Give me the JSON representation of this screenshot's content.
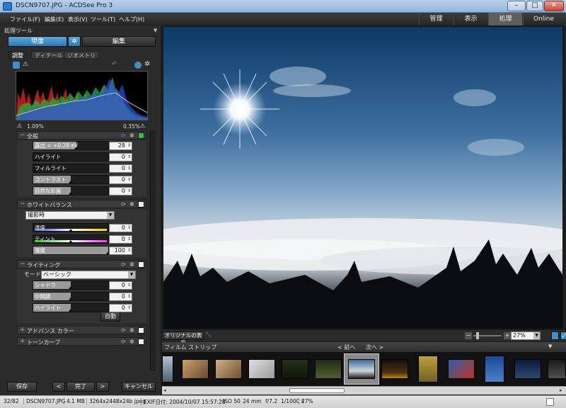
{
  "window": {
    "title": "DSCN9707.JPG - ACDSee Pro 3",
    "min": "–",
    "max": "□",
    "close": "✕"
  },
  "menu": [
    "ファイル(F)",
    "編集(E)",
    "表示(V)",
    "ツール(T)",
    "ヘルプ(H)"
  ],
  "modes": {
    "manage": "管理",
    "view": "表示",
    "process": "処理",
    "online": "Online",
    "active": "処理"
  },
  "left": {
    "panel_title": "処理ツール",
    "develop_tab": "現像",
    "edit_tab": "編集",
    "subtabs": [
      "調整",
      "ディテール",
      "ジオメトリ"
    ],
    "histogram": {
      "left_pct": "1.09%",
      "right_pct": "0.35%"
    },
    "general": {
      "title": "全般",
      "sliders": [
        {
          "label": "露出 = +0.28 eV",
          "value": "28",
          "level": 0.58
        },
        {
          "label": "ハイライト",
          "value": "0",
          "level": 0.0
        },
        {
          "label": "フィルライト",
          "value": "0",
          "level": 0.0
        },
        {
          "label": "コントラスト",
          "value": "0",
          "level": 0.5
        },
        {
          "label": "自然な彩度",
          "value": "0",
          "level": 0.5
        }
      ]
    },
    "white_balance": {
      "title": "ホワイトバランス",
      "preset": "撮影時",
      "sliders": [
        {
          "label": "温度",
          "value": "0",
          "level": 0.5
        },
        {
          "label": "ティント",
          "value": "0",
          "level": 0.5
        },
        {
          "label": "強度",
          "value": "100",
          "level": 1.0
        }
      ]
    },
    "lighting": {
      "title": "ライティング",
      "mode_label": "モード",
      "mode": "ベーシック",
      "sliders": [
        {
          "label": "シャドウ",
          "value": "0",
          "level": 0.5
        },
        {
          "label": "中間調",
          "value": "0",
          "level": 0.5
        },
        {
          "label": "ハイライト",
          "value": "0",
          "level": 0.5
        }
      ],
      "auto": "自動"
    },
    "advanced_color": {
      "title": "アドバンス カラー"
    },
    "tone_curve": {
      "title": "トーンカーブ"
    },
    "footer": {
      "save": "保存",
      "prev": "<",
      "done": "完了",
      "next": ">",
      "cancel": "キャンセル"
    }
  },
  "viewer": {
    "original_btn": "オリジナルの表示",
    "zoom": "27%",
    "zoom_minus": "−",
    "zoom_plus": "+"
  },
  "filmstrip": {
    "title": "フィルム ストリップ",
    "prev": "< 前へ",
    "next": "次へ >"
  },
  "status": {
    "index": "32/82",
    "file": "DSCN9707.JPG",
    "size": "4.1 MB",
    "dims": "3264x2448x24b jpeg",
    "exif": "EXIF日付: 2004/10/07 15:57:28",
    "iso": "ISO 50",
    "focal": "24 mm",
    "fstop": "f/7.2",
    "shutter": "1/1000 s",
    "zoom": "27%"
  },
  "colors": {
    "accent": "#3d8ec9",
    "panel": "#2b2b2b",
    "active_tab": "#5e5e5e"
  }
}
